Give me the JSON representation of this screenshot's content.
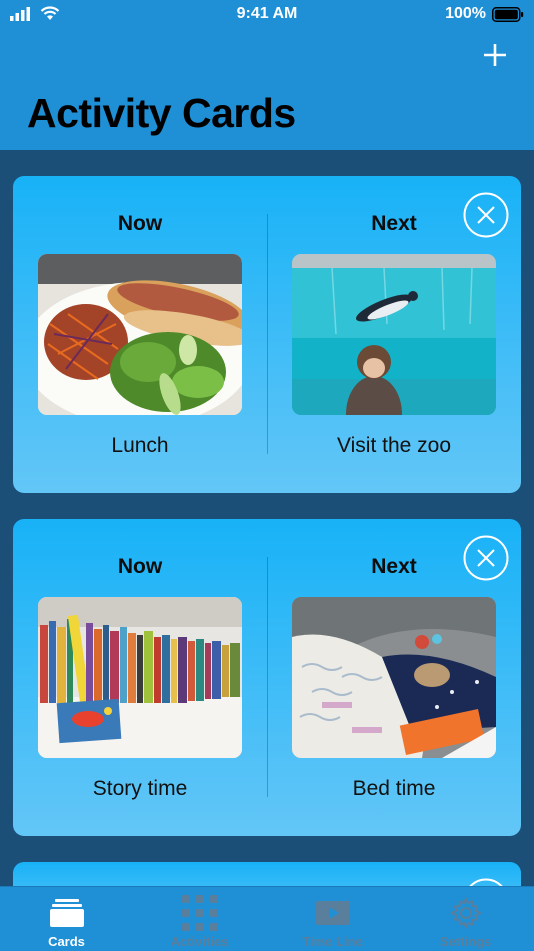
{
  "status": {
    "time": "9:41 AM",
    "battery": "100%"
  },
  "header": {
    "title": "Activity Cards"
  },
  "cards": [
    {
      "now": {
        "label": "Now",
        "caption": "Lunch",
        "image": "lunch-photo"
      },
      "next": {
        "label": "Next",
        "caption": "Visit the zoo",
        "image": "zoo-photo"
      }
    },
    {
      "now": {
        "label": "Now",
        "caption": "Story time",
        "image": "books-photo"
      },
      "next": {
        "label": "Next",
        "caption": "Bed time",
        "image": "bed-photo"
      }
    }
  ],
  "tabs": [
    {
      "label": "Cards",
      "icon": "cards-icon",
      "active": true
    },
    {
      "label": "Activities",
      "icon": "grid-icon",
      "active": false
    },
    {
      "label": "Time Line",
      "icon": "play-icon",
      "active": false
    },
    {
      "label": "Settings",
      "icon": "gear-icon",
      "active": false
    }
  ],
  "colors": {
    "accent": "#1f8fd6",
    "background": "#1b4f78",
    "card_top": "#18b2f7",
    "card_bottom": "#63c6f7"
  }
}
